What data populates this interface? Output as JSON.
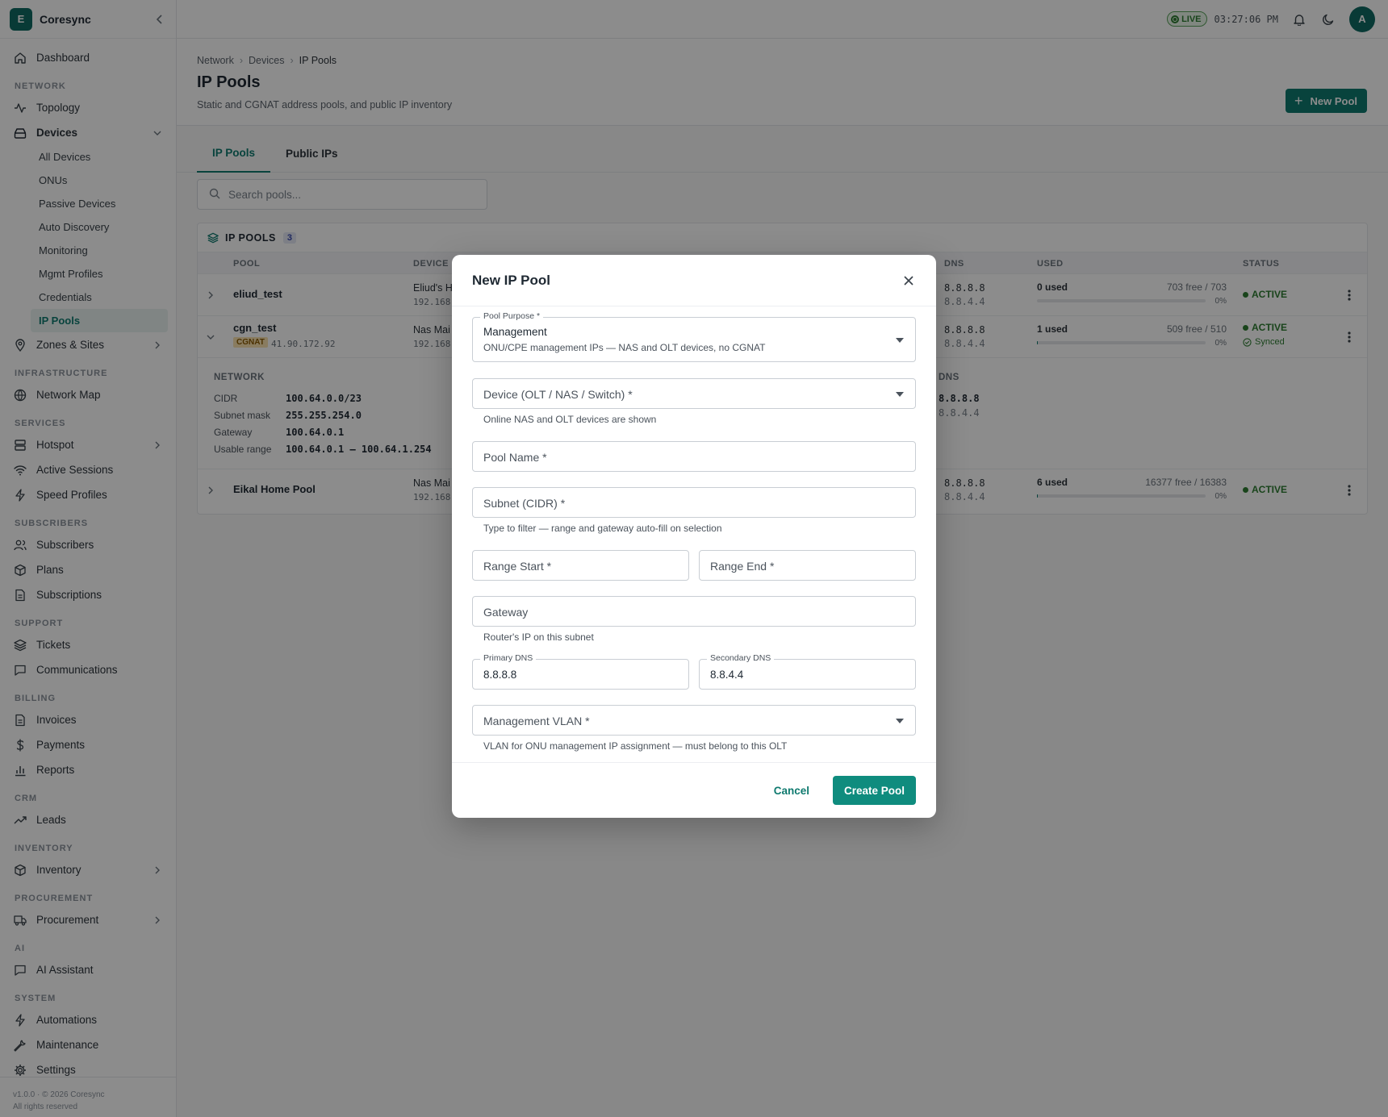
{
  "app": {
    "logo_letter": "E",
    "name": "Coresync"
  },
  "sidebar": {
    "dashboard": "Dashboard",
    "sec_network": "NETWORK",
    "topology": "Topology",
    "devices": "Devices",
    "sub_devices": [
      "All Devices",
      "ONUs",
      "Passive Devices",
      "Auto Discovery",
      "Monitoring",
      "Mgmt Profiles",
      "Credentials",
      "IP Pools"
    ],
    "zones": "Zones & Sites",
    "sec_infra": "INFRASTRUCTURE",
    "network_map": "Network Map",
    "sec_services": "SERVICES",
    "hotspot": "Hotspot",
    "active_sessions": "Active Sessions",
    "speed_profiles": "Speed Profiles",
    "sec_subscribers": "SUBSCRIBERS",
    "subscribers": "Subscribers",
    "plans": "Plans",
    "subscriptions": "Subscriptions",
    "sec_support": "SUPPORT",
    "tickets": "Tickets",
    "communications": "Communications",
    "sec_billing": "BILLING",
    "invoices": "Invoices",
    "payments": "Payments",
    "reports": "Reports",
    "sec_crm": "CRM",
    "leads": "Leads",
    "sec_inventory": "INVENTORY",
    "inventory": "Inventory",
    "sec_procurement": "PROCUREMENT",
    "procurement": "Procurement",
    "sec_ai": "AI",
    "ai_assistant": "AI Assistant",
    "sec_system": "SYSTEM",
    "automations": "Automations",
    "maintenance": "Maintenance",
    "settings": "Settings",
    "footer_line1": "v1.0.0 · © 2026 Coresync",
    "footer_line2": "All rights reserved"
  },
  "topbar": {
    "live": "LIVE",
    "time": "03:27:06 PM",
    "avatar": "A"
  },
  "page": {
    "breadcrumb": [
      "Network",
      "Devices",
      "IP Pools"
    ],
    "title": "IP Pools",
    "subtitle": "Static and CGNAT address pools, and public IP inventory",
    "new_pool": "New Pool",
    "tabs": [
      "IP Pools",
      "Public IPs"
    ],
    "search_placeholder": "Search pools..."
  },
  "table": {
    "title": "IP POOLS",
    "count": "3",
    "headers": {
      "pool": "POOL",
      "device": "DEVICE",
      "dns": "DNS",
      "used": "USED",
      "status": "STATUS"
    },
    "rows": [
      {
        "pool": "eliud_test",
        "device": "Eliud's H",
        "device_ip": "192.168",
        "dns1": "8.8.8.8",
        "dns2": "8.8.4.4",
        "used": "0 used",
        "free": "703 free / 703",
        "pct": "0%",
        "used_fraction": 0,
        "status": "ACTIVE"
      },
      {
        "pool": "cgn_test",
        "tag": "CGNAT",
        "tag_ip": "41.90.172.92",
        "device": "Nas Mai",
        "device_ip": "192.168",
        "dns1": "8.8.8.8",
        "dns2": "8.8.4.4",
        "used": "1 used",
        "free": "509 free / 510",
        "pct": "0%",
        "used_fraction": 0.002,
        "status": "ACTIVE",
        "sync": "Synced"
      },
      {
        "pool": "Eikal Home Pool",
        "device": "Nas Mai",
        "device_ip": "192.168",
        "dns1": "8.8.8.8",
        "dns2": "8.8.4.4",
        "used": "6 used",
        "free": "16377 free / 16383",
        "pct": "0%",
        "used_fraction": 0.0004,
        "status": "ACTIVE"
      }
    ],
    "detail": {
      "network_label": "NETWORK",
      "cidr_k": "CIDR",
      "cidr_v": "100.64.0.0/23",
      "mask_k": "Subnet mask",
      "mask_v": "255.255.254.0",
      "gw_k": "Gateway",
      "gw_v": "100.64.0.1",
      "range_k": "Usable range",
      "range_v": "100.64.0.1 — 100.64.1.254",
      "dns_label": "DNS",
      "dns1": "8.8.8.8",
      "dns2": "8.8.4.4"
    }
  },
  "modal": {
    "title": "New IP Pool",
    "purpose_label": "Pool Purpose *",
    "purpose_value": "Management",
    "purpose_desc": "ONU/CPE management IPs — NAS and OLT devices, no CGNAT",
    "device_ph": "Device (OLT / NAS / Switch) *",
    "device_help": "Online NAS and OLT devices are shown",
    "pool_name_ph": "Pool Name *",
    "subnet_ph": "Subnet (CIDR) *",
    "subnet_help": "Type to filter — range and gateway auto-fill on selection",
    "range_start_ph": "Range Start *",
    "range_end_ph": "Range End *",
    "gateway_ph": "Gateway",
    "gateway_help": "Router's IP on this subnet",
    "primary_dns_label": "Primary DNS",
    "primary_dns_value": "8.8.8.8",
    "secondary_dns_label": "Secondary DNS",
    "secondary_dns_value": "8.8.4.4",
    "vlan_ph": "Management VLAN *",
    "vlan_help": "VLAN for ONU management IP assignment — must belong to this OLT",
    "cancel": "Cancel",
    "create": "Create Pool"
  }
}
